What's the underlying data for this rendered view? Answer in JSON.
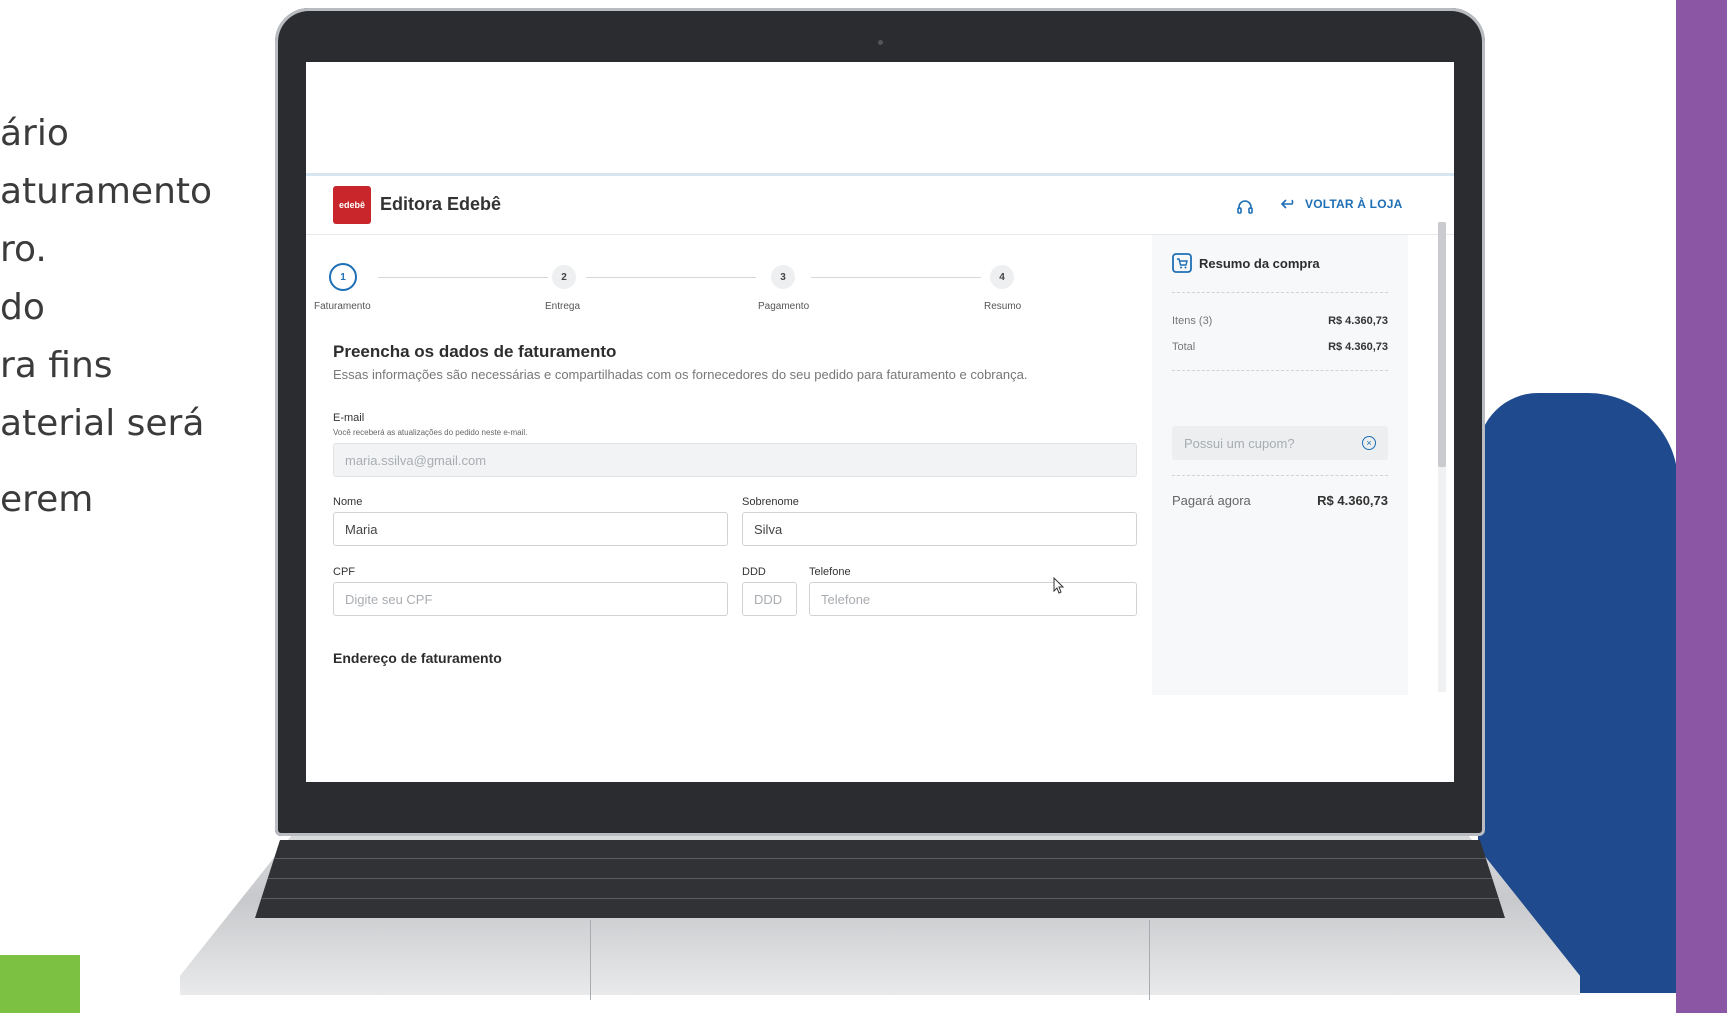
{
  "side_text_lines": [
    "ário",
    "aturamento",
    "ro.",
    "do",
    "ra fins",
    "aterial será",
    "erem"
  ],
  "app": {
    "logo_text": "edebê",
    "brand": "Editora Edebê",
    "back_label": "VOLTAR À LOJA"
  },
  "steps": [
    {
      "number": "1",
      "label": "Faturamento",
      "active": true
    },
    {
      "number": "2",
      "label": "Entrega",
      "active": false
    },
    {
      "number": "3",
      "label": "Pagamento",
      "active": false
    },
    {
      "number": "4",
      "label": "Resumo",
      "active": false
    }
  ],
  "form": {
    "title": "Preencha os dados de faturamento",
    "subtitle": "Essas informações são necessárias e compartilhadas com os fornecedores do seu pedido para faturamento e cobrança.",
    "email": {
      "label": "E-mail",
      "hint": "Você receberá as atualizações do pedido neste e-mail.",
      "value": "maria.ssilva@gmail.com"
    },
    "nome": {
      "label": "Nome",
      "value": "Maria"
    },
    "sobrenome": {
      "label": "Sobrenome",
      "value": "Silva"
    },
    "cpf": {
      "label": "CPF",
      "placeholder": "Digite seu CPF"
    },
    "ddd": {
      "label": "DDD",
      "placeholder": "DDD"
    },
    "telefone": {
      "label": "Telefone",
      "placeholder": "Telefone"
    },
    "address_title": "Endereço de faturamento"
  },
  "summary": {
    "title": "Resumo da compra",
    "items_label": "Itens (3)",
    "items_value": "R$ 4.360,73",
    "total_label": "Total",
    "total_value": "R$ 4.360,73",
    "coupon_placeholder": "Possui um cupom?",
    "pay_label": "Pagará agora",
    "pay_value": "R$ 4.360,73"
  },
  "colors": {
    "accent": "#1e6fb6",
    "brand_red": "#c8262b",
    "deco_purple": "#8b57a4",
    "deco_blue": "#1f4b8e",
    "deco_green": "#7cc142"
  }
}
